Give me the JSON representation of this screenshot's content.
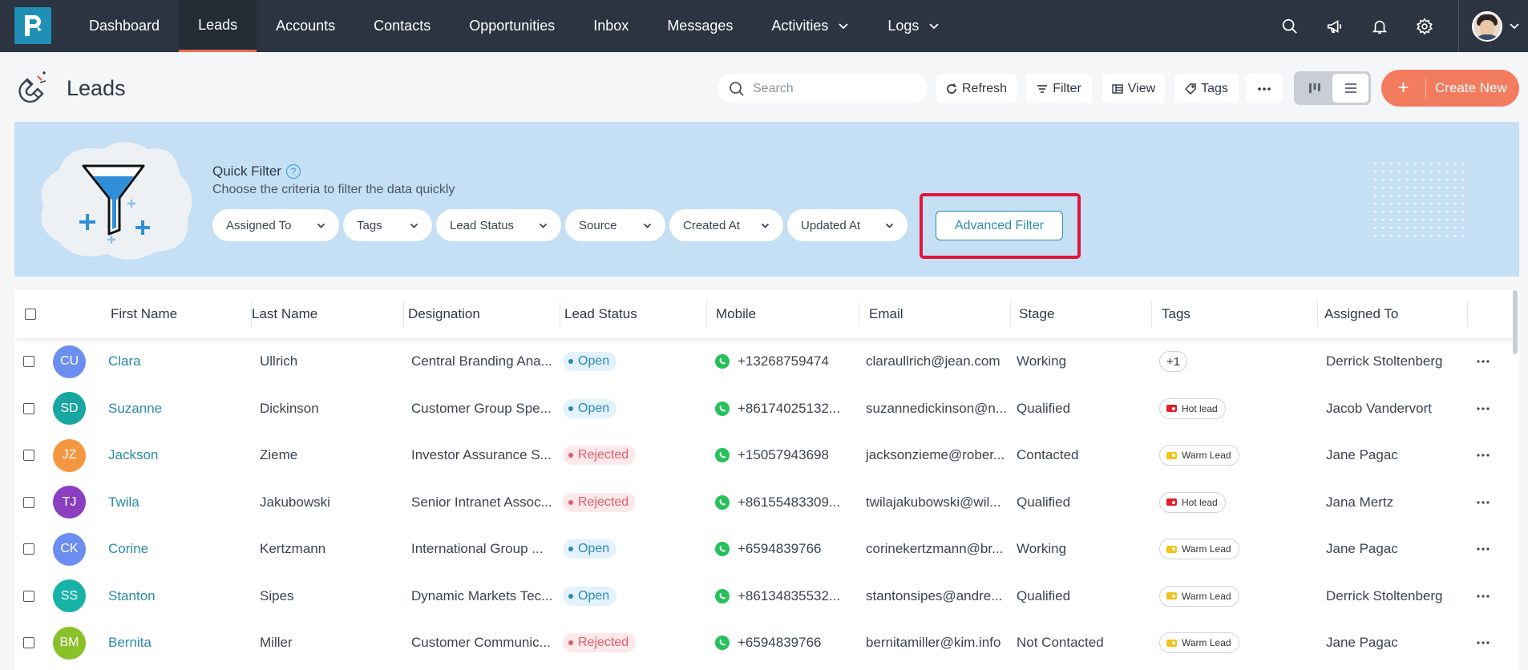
{
  "nav": {
    "items": [
      {
        "label": "Dashboard"
      },
      {
        "label": "Leads",
        "active": true
      },
      {
        "label": "Accounts"
      },
      {
        "label": "Contacts"
      },
      {
        "label": "Opportunities"
      },
      {
        "label": "Inbox"
      },
      {
        "label": "Messages"
      },
      {
        "label": "Activities",
        "dropdown": true
      },
      {
        "label": "Logs",
        "dropdown": true
      }
    ],
    "right_icons": [
      "search-icon",
      "megaphone-icon",
      "bell-icon",
      "gear-icon"
    ]
  },
  "header": {
    "title": "Leads",
    "search_placeholder": "Search",
    "refresh_label": "Refresh",
    "filter_label": "Filter",
    "view_label": "View",
    "tags_label": "Tags",
    "create_label": "Create New"
  },
  "quick_filter": {
    "title": "Quick Filter",
    "help": "?",
    "subtitle": "Choose the criteria to filter the data quickly",
    "chips": [
      "Assigned To",
      "Tags",
      "Lead Status",
      "Source",
      "Created At",
      "Updated At"
    ],
    "advanced_label": "Advanced Filter"
  },
  "table": {
    "columns": [
      "First Name",
      "Last Name",
      "Designation",
      "Lead Status",
      "Mobile",
      "Email",
      "Stage",
      "Tags",
      "Assigned To"
    ],
    "rows": [
      {
        "initials": "CU",
        "avatar_color": "#6c8ef0",
        "first": "Clara",
        "last": "Ullrich",
        "designation": "Central Branding Ana...",
        "status": "Open",
        "mobile": "+13268759474",
        "email": "claraullrich@jean.com",
        "stage": "Working",
        "tag": "+1",
        "tag_type": "plus",
        "assigned": "Derrick Stoltenberg"
      },
      {
        "initials": "SD",
        "avatar_color": "#17a6a0",
        "first": "Suzanne",
        "last": "Dickinson",
        "designation": "Customer Group Spe...",
        "status": "Open",
        "mobile": "+86174025132...",
        "email": "suzannedickinson@n...",
        "stage": "Qualified",
        "tag": "Hot lead",
        "tag_type": "hot",
        "assigned": "Jacob Vandervort"
      },
      {
        "initials": "JZ",
        "avatar_color": "#f59640",
        "first": "Jackson",
        "last": "Zieme",
        "designation": "Investor Assurance S...",
        "status": "Rejected",
        "mobile": "+15057943698",
        "email": "jacksonzieme@rober...",
        "stage": "Contacted",
        "tag": "Warm Lead",
        "tag_type": "warm",
        "assigned": "Jane Pagac"
      },
      {
        "initials": "TJ",
        "avatar_color": "#8a3fc0",
        "first": "Twila",
        "last": "Jakubowski",
        "designation": "Senior Intranet Assoc...",
        "status": "Rejected",
        "mobile": "+86155483309...",
        "email": "twilajakubowski@wil...",
        "stage": "Qualified",
        "tag": "Hot lead",
        "tag_type": "hot",
        "assigned": "Jana Mertz"
      },
      {
        "initials": "CK",
        "avatar_color": "#6c8ef0",
        "first": "Corine",
        "last": "Kertzmann",
        "designation": "International Group ...",
        "status": "Open",
        "mobile": "+6594839766",
        "email": "corinekertzmann@br...",
        "stage": "Working",
        "tag": "Warm Lead",
        "tag_type": "warm",
        "assigned": "Jane Pagac"
      },
      {
        "initials": "SS",
        "avatar_color": "#17b2a6",
        "first": "Stanton",
        "last": "Sipes",
        "designation": "Dynamic Markets Tec...",
        "status": "Open",
        "mobile": "+86134835532...",
        "email": "stantonsipes@andre...",
        "stage": "Qualified",
        "tag": "Warm Lead",
        "tag_type": "warm",
        "assigned": "Derrick Stoltenberg"
      },
      {
        "initials": "BM",
        "avatar_color": "#8ac028",
        "first": "Bernita",
        "last": "Miller",
        "designation": "Customer Communic...",
        "status": "Rejected",
        "mobile": "+6594839766",
        "email": "bernitamiller@kim.info",
        "stage": "Not Contacted",
        "tag": "Warm Lead",
        "tag_type": "warm",
        "assigned": "Jane Pagac"
      }
    ]
  },
  "colors": {
    "nav_bg": "#2b3440",
    "accent": "#f47c5e",
    "link": "#2a8aa8",
    "highlight": "#e3143c",
    "banner": "#c5dff5"
  }
}
